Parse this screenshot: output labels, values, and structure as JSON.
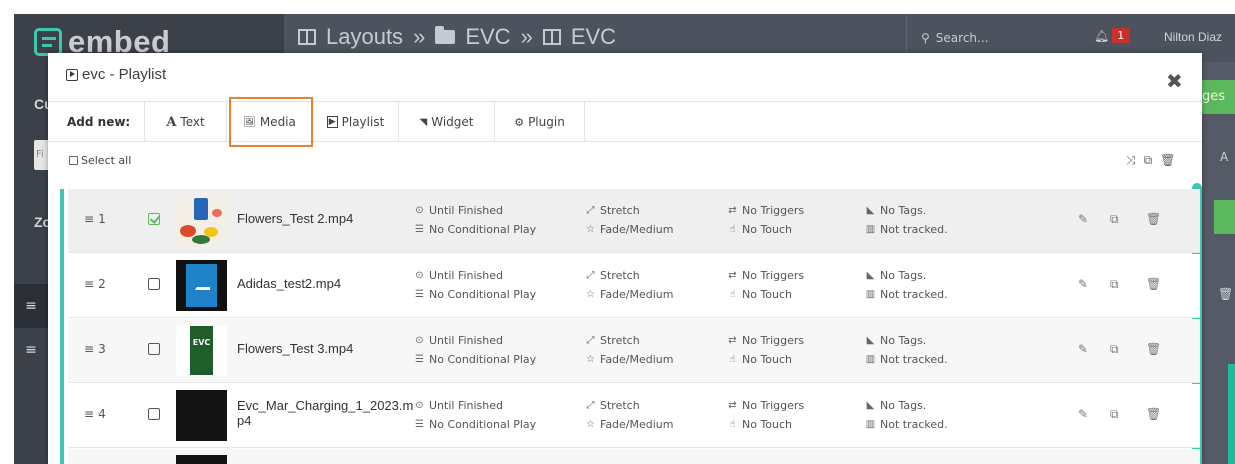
{
  "app": {
    "logo_text": "embed",
    "breadcrumb": [
      "Layouts",
      "»",
      "EVC",
      "»",
      "EVC"
    ],
    "search_placeholder": "Search...",
    "notification_count": "1",
    "user_name": "Nilton Diaz",
    "sidebar_fragments": [
      "Cu",
      "Fi",
      "Zo"
    ],
    "right_fragments": [
      "ges",
      "A"
    ]
  },
  "modal": {
    "title": "evc - Playlist",
    "close_symbol": "✖",
    "add_new_label": "Add new:",
    "add_buttons": [
      {
        "label": "Text",
        "icon": "A"
      },
      {
        "label": "Media",
        "icon": "🖼"
      },
      {
        "label": "Playlist",
        "icon": "▶"
      },
      {
        "label": "Widget",
        "icon": "◥"
      },
      {
        "label": "Plugin",
        "icon": "⚙"
      }
    ],
    "select_all_label": "Select all"
  },
  "rows": [
    {
      "index": "1",
      "checked": true,
      "file": "Flowers_Test 2.mp4",
      "duration": "Until Finished",
      "conditional": "No Conditional Play",
      "scale": "Stretch",
      "transition": "Fade/Medium",
      "triggers": "No Triggers",
      "touch": "No Touch",
      "tags": "No Tags.",
      "tracking": "Not tracked."
    },
    {
      "index": "2",
      "checked": false,
      "file": "Adidas_test2.mp4",
      "duration": "Until Finished",
      "conditional": "No Conditional Play",
      "scale": "Stretch",
      "transition": "Fade/Medium",
      "triggers": "No Triggers",
      "touch": "No Touch",
      "tags": "No Tags.",
      "tracking": "Not tracked."
    },
    {
      "index": "3",
      "checked": false,
      "file": "Flowers_Test 3.mp4",
      "duration": "Until Finished",
      "conditional": "No Conditional Play",
      "scale": "Stretch",
      "transition": "Fade/Medium",
      "triggers": "No Triggers",
      "touch": "No Touch",
      "tags": "No Tags.",
      "tracking": "Not tracked."
    },
    {
      "index": "4",
      "checked": false,
      "file": "Evc_Mar_Charging_1_2023.mp4",
      "duration": "Until Finished",
      "conditional": "No Conditional Play",
      "scale": "Stretch",
      "transition": "Fade/Medium",
      "triggers": "No Triggers",
      "touch": "No Touch",
      "tags": "No Tags.",
      "tracking": "Not tracked."
    }
  ],
  "thumb_poster_text": "EVC",
  "colors": {
    "accent_teal": "#3ec7b0",
    "highlight_orange": "#e8822f",
    "check_green": "#5cb85c",
    "badge_red": "#c9302c"
  }
}
